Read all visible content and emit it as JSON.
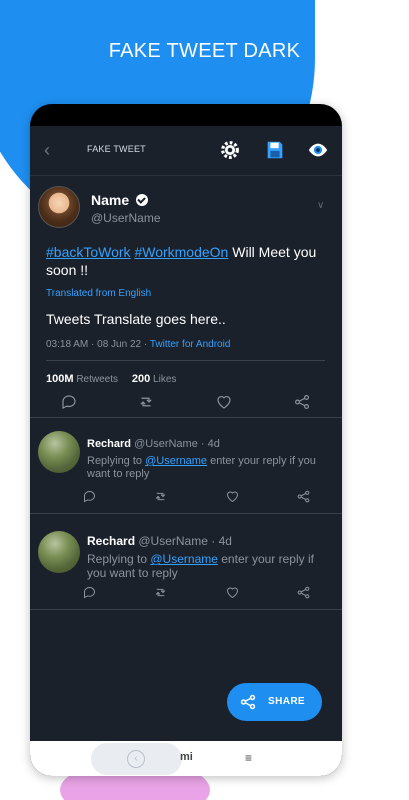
{
  "promo": {
    "headline": "FAKE TWEET DARK"
  },
  "appbar": {
    "title": "FAKE TWEET",
    "back_icon": "back-arrow-icon",
    "icons": [
      "gear-icon",
      "save-icon",
      "eye-icon"
    ]
  },
  "tweet": {
    "name": "Name",
    "handle": "@UserName",
    "hashtag1": "#backToWork",
    "hashtag2": "#WorkmodeOn",
    "text_rest": " Will Meet you soon !!",
    "translated_label": "Translated from English",
    "translation": "Tweets Translate goes here..",
    "time": "03:18 AM",
    "date": "08 Jun 22",
    "source": "Twitter for Android",
    "retweets_count": "100M",
    "retweets_label": "Retweets",
    "likes_count": "200",
    "likes_label": "Likes"
  },
  "replies": [
    {
      "name": "Rechard",
      "handle": "@UserName",
      "age": "4d",
      "replying_prefix": "Replying to ",
      "mention": "@Username",
      "reply_text": " enter your reply if you want to reply"
    },
    {
      "name": "Rechard",
      "handle": "@UserName",
      "age": "4d",
      "replying_prefix": "Replying to ",
      "mention": "@Username",
      "reply_text": " enter your reply if you want to reply"
    }
  ],
  "share_button": {
    "label": "SHARE"
  },
  "navbar": {
    "mi_label": "mi",
    "menu_label": "≡"
  },
  "colors": {
    "accent": "#1e8ff0",
    "link": "#35a1ff",
    "background": "#1b212b"
  }
}
